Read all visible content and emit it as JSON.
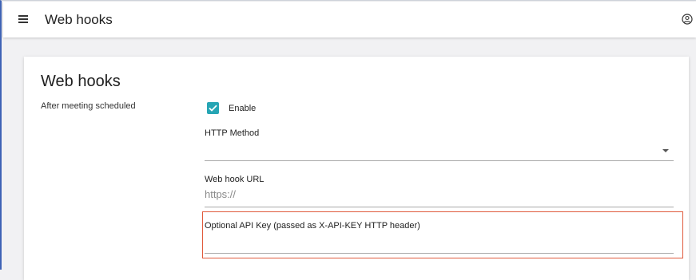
{
  "appbar": {
    "title": "Web hooks",
    "menu_icon": "hamburger-menu-icon",
    "account_icon": "account-circle-icon"
  },
  "card": {
    "title": "Web hooks",
    "section_label": "After meeting scheduled",
    "enable": {
      "label": "Enable",
      "checked": true
    },
    "http_method": {
      "label": "HTTP Method",
      "value": ""
    },
    "webhook_url": {
      "label": "Web hook URL",
      "placeholder": "https://",
      "value": ""
    },
    "api_key": {
      "label": "Optional API Key (passed as X-API-KEY HTTP header)",
      "value": ""
    }
  },
  "colors": {
    "checkbox": "#26a5b4",
    "highlight": "#e05a3c",
    "frame_left_border": "#3f63b5"
  }
}
